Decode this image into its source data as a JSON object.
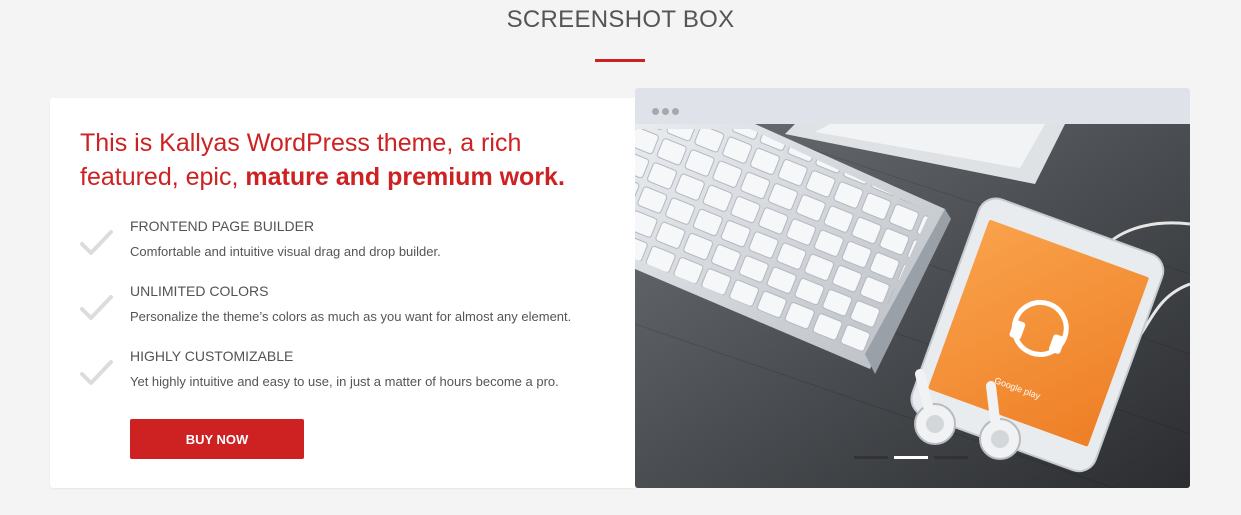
{
  "section": {
    "title": "SCREENSHOT BOX"
  },
  "box": {
    "headline_prefix": "This is Kallyas WordPress theme, a rich featured, epic, ",
    "headline_bold": "mature and premium work.",
    "features": [
      {
        "title": "FRONTEND PAGE BUILDER",
        "description": "Comfortable and intuitive visual drag and drop builder."
      },
      {
        "title": "UNLIMITED COLORS",
        "description": "Personalize the theme’s colors as much as you want for almost any element."
      },
      {
        "title": "HIGHLY CUSTOMIZABLE",
        "description": "Yet highly intuitive and easy to use, in just a matter of hours become a pro."
      }
    ],
    "button_label": "BUY NOW"
  },
  "slider": {
    "phone_label": "Google play",
    "slides_count": 3,
    "active_slide": 2
  },
  "colors": {
    "accent": "#cd2122",
    "background": "#f4f4f4",
    "browser_bar": "#e0e2ea"
  },
  "icons": {
    "feature_icon": "checkmark-icon",
    "window_icon": "window-dots-icon",
    "phone_icon": "headphones-icon"
  }
}
